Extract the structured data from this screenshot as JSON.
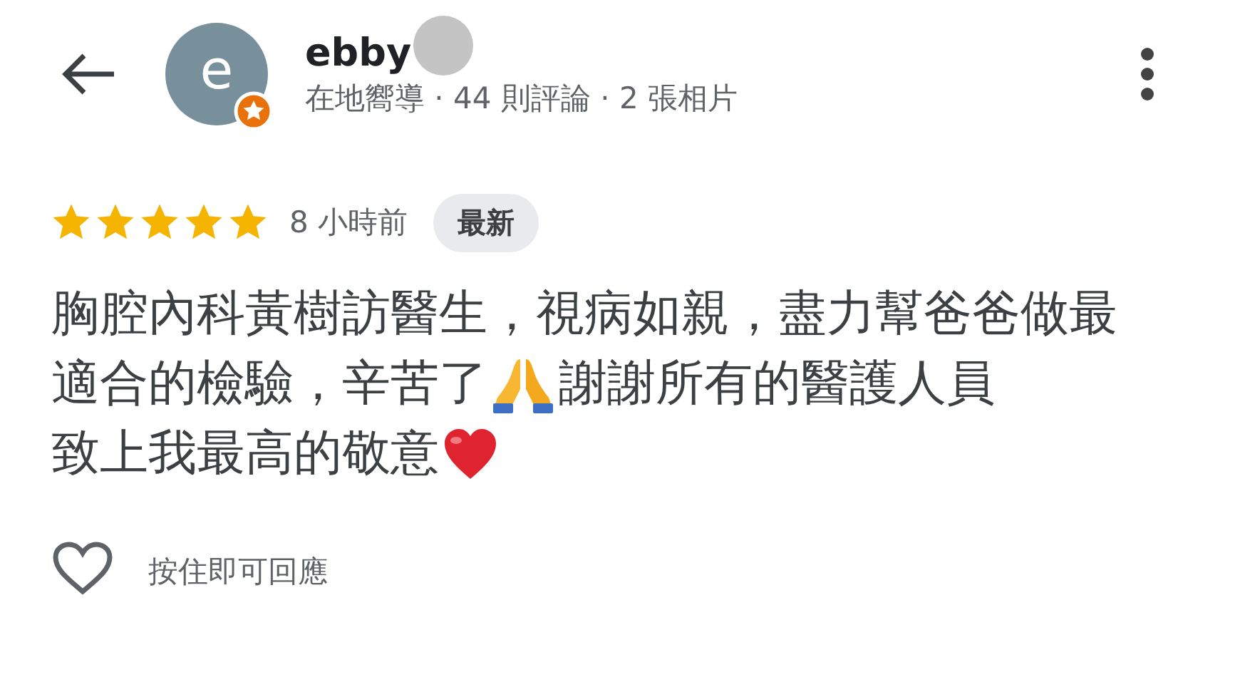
{
  "reviewer": {
    "avatar_initial": "e",
    "name": "ebby",
    "subtitle": "在地嚮導 · 44 則評論 · 2 張相片",
    "local_guide": true
  },
  "review": {
    "stars": 5,
    "time": "8 小時前",
    "badge": "最新",
    "lines": [
      [
        {
          "kind": "text",
          "text": "胸腔內科黃樹訪醫生，視病如親，盡力幫爸爸做最"
        }
      ],
      [
        {
          "kind": "text",
          "text": "適合的檢驗，辛苦了"
        },
        {
          "kind": "pray"
        },
        {
          "kind": "text",
          "text": "謝謝所有的醫護人員"
        }
      ],
      [
        {
          "kind": "text",
          "text": "致上我最高的敬意"
        },
        {
          "kind": "heart"
        }
      ]
    ]
  },
  "reaction": {
    "liked": false,
    "hint": "按住即可回應"
  }
}
